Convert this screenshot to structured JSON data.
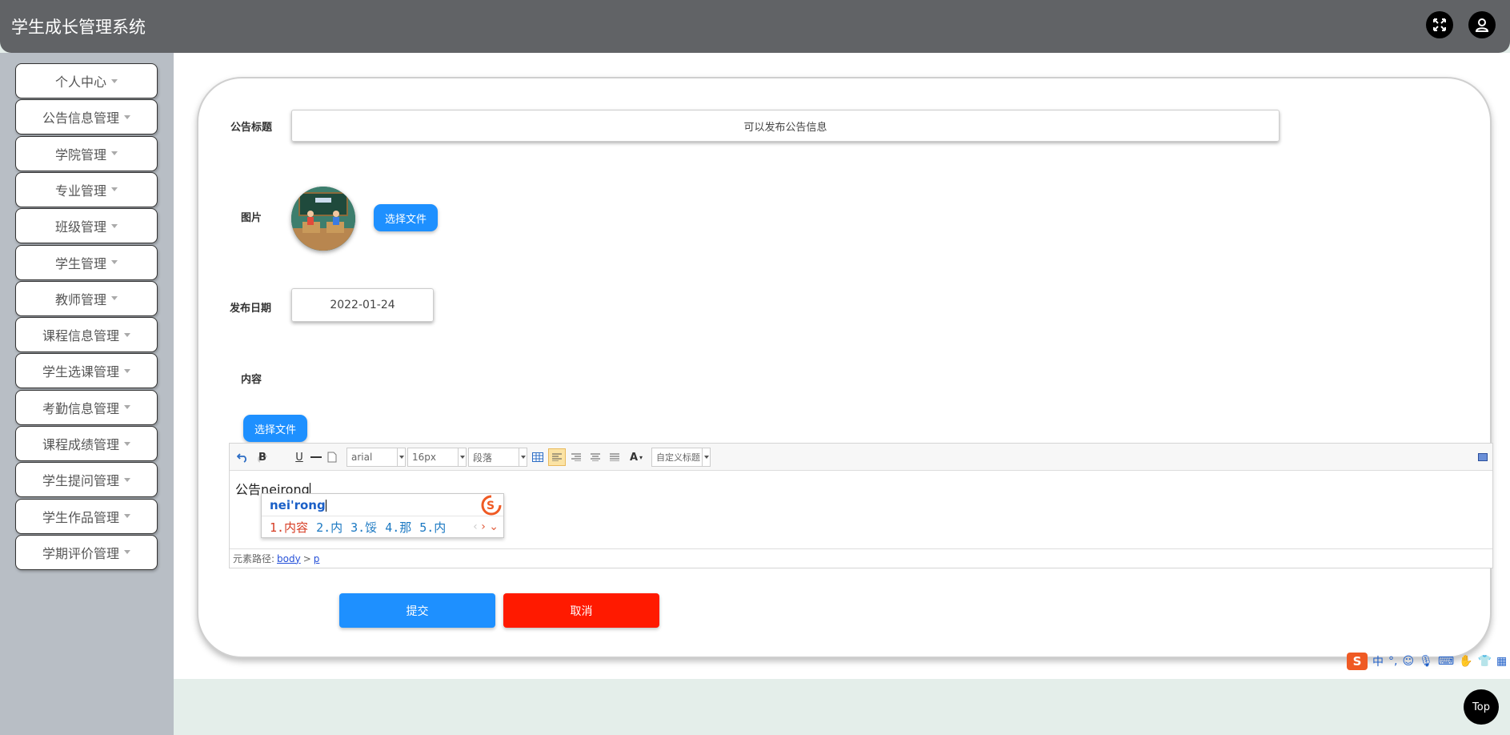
{
  "header": {
    "app_title": "学生成长管理系统",
    "fullscreen_icon": "fullscreen-icon",
    "user_icon": "user-icon"
  },
  "sidebar": {
    "items": [
      {
        "label": "个人中心"
      },
      {
        "label": "公告信息管理"
      },
      {
        "label": "学院管理"
      },
      {
        "label": "专业管理"
      },
      {
        "label": "班级管理"
      },
      {
        "label": "学生管理"
      },
      {
        "label": "教师管理"
      },
      {
        "label": "课程信息管理"
      },
      {
        "label": "学生选课管理"
      },
      {
        "label": "考勤信息管理"
      },
      {
        "label": "课程成绩管理"
      },
      {
        "label": "学生提问管理"
      },
      {
        "label": "学生作品管理"
      },
      {
        "label": "学期评价管理"
      }
    ]
  },
  "form": {
    "title_label": "公告标题",
    "title_value": "可以发布公告信息",
    "image_label": "图片",
    "image_upload_label": "选择文件",
    "date_label": "发布日期",
    "date_value": "2022-01-24",
    "content_label": "内容",
    "content_upload_label": "选择文件",
    "submit_label": "提交",
    "cancel_label": "取消"
  },
  "editor": {
    "font_family": "arial",
    "font_size": "16px",
    "paragraph": "段落",
    "custom_title": "自定义标题",
    "font_color_glyph": "A",
    "bold": "B",
    "underline": "U",
    "content_text": "公告neirong",
    "path_label": "元素路径:",
    "path_body": "body",
    "path_sep": ">",
    "path_p": "p"
  },
  "ime_popup": {
    "input": "nei'rong",
    "candidates": [
      "1.内容",
      "2.内",
      "3.馁",
      "4.那",
      "5.内"
    ]
  },
  "ime_status": {
    "mode": "中",
    "punct": "°,"
  },
  "back_to_top": "Top",
  "colors": {
    "header_bg": "#616366",
    "sidebar_bg": "#b8bec5",
    "primary": "#1e90ff",
    "danger": "#ff1a00",
    "ime_brand": "#ef5a24"
  }
}
